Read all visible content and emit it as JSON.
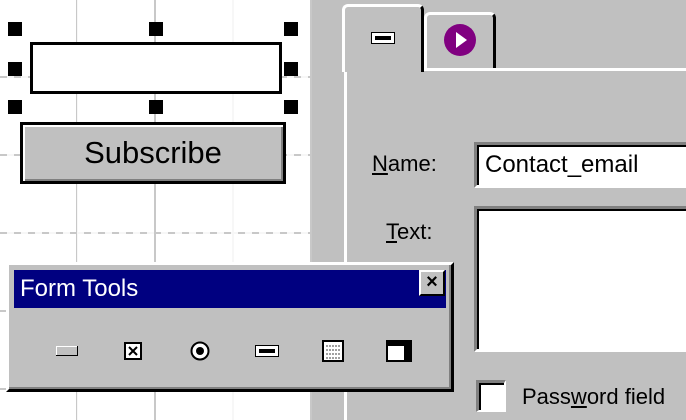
{
  "canvas": {
    "button_label": "Subscribe"
  },
  "toolbox": {
    "title": "Form Tools",
    "close_glyph": "×",
    "tools": [
      "button-tool-icon",
      "checkbox-tool-icon",
      "radio-tool-icon",
      "textfield-tool-icon",
      "listbox-tool-icon",
      "dropdown-tool-icon"
    ]
  },
  "properties": {
    "tabs": [
      "textfield-tab-icon",
      "actions-tab-icon"
    ],
    "name_label_accel": "N",
    "name_label_rest": "ame:",
    "name_value": "Contact_email",
    "text_label_accel": "T",
    "text_label_rest": "ext:",
    "text_value": "",
    "password_label_pre": "Pass",
    "password_label_accel": "w",
    "password_label_post": "ord field"
  },
  "colors": {
    "face": "#c0c0c0",
    "titlebar": "#000080",
    "tab_icon_purple": "#800080"
  }
}
